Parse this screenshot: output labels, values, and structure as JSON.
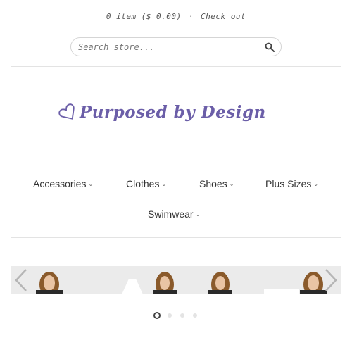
{
  "cart": {
    "summary": "0 item ($ 0.00)",
    "separator": "·",
    "checkout_label": "Check out"
  },
  "search": {
    "placeholder": "Search store...",
    "icon": "search-icon"
  },
  "logo": {
    "text": "Purposed by Design",
    "icon": "heart-outline-icon",
    "color": "#6b5ea8"
  },
  "nav": {
    "items": [
      {
        "label": "Accessories",
        "chevron": "⌄"
      },
      {
        "label": "Clothes",
        "chevron": "⌄"
      },
      {
        "label": "Shoes",
        "chevron": "⌄"
      },
      {
        "label": "Plus Sizes",
        "chevron": "⌄"
      },
      {
        "label": "Swimwear",
        "chevron": "⌄"
      }
    ]
  },
  "slider": {
    "prev_icon": "chevron-left-icon",
    "next_icon": "chevron-right-icon",
    "current_slide": 1,
    "slide_count": 4
  }
}
